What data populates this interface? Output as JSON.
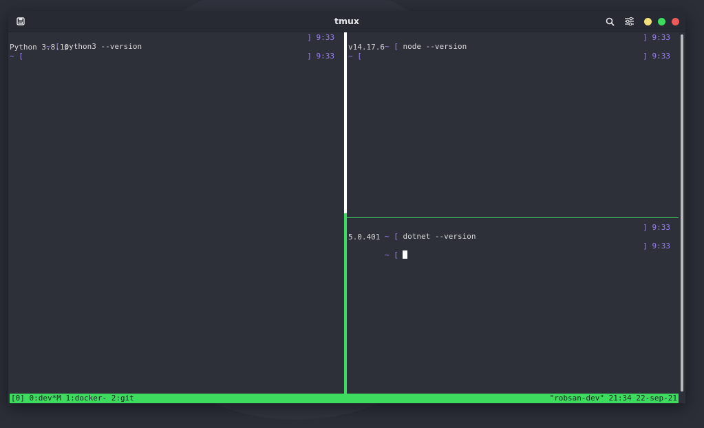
{
  "window": {
    "title": "tmux",
    "icons": {
      "app": "save-icon",
      "search": "search-icon",
      "settings": "sliders-icon",
      "minimize": "minimize-dot",
      "maximize": "maximize-dot",
      "close": "close-dot"
    },
    "colors": {
      "minimize": "#f3e07a",
      "maximize": "#3ddc5f",
      "close": "#ee5a5a",
      "accent": "#3ddc5f",
      "prompt": "#9b7ff0"
    }
  },
  "panes": {
    "left": {
      "cmd_prompt": "~ [",
      "cmd_text": " python3 --version",
      "cmd_time": "] 9:33",
      "output": "Python 3.8.10",
      "prompt2": "~ [",
      "prompt2_time": "] 9:33"
    },
    "top_right": {
      "cmd_prompt": "~ [",
      "cmd_text": " node --version",
      "cmd_time": "] 9:33",
      "output": "v14.17.6",
      "prompt2": "~ [",
      "prompt2_time": "] 9:33"
    },
    "bottom_right": {
      "cmd_prompt": "~ [",
      "cmd_text": " dotnet --version",
      "cmd_time": "] 9:33",
      "output": "5.0.401",
      "prompt2": "~ [",
      "prompt2_time": "] 9:33"
    }
  },
  "statusbar": {
    "left": "[0] 0:dev*M 1:docker- 2:git",
    "right": "\"robsan-dev\" 21:34 22-sep-21"
  }
}
